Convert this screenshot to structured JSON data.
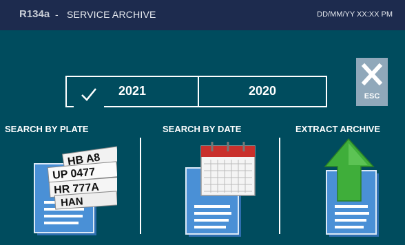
{
  "header": {
    "model": "R134a",
    "separator": "-",
    "title": "SERVICE ARCHIVE",
    "datetime": "DD/MM/YY XX:XX PM"
  },
  "year_selector": {
    "years": [
      {
        "label": "2021",
        "selected": true
      },
      {
        "label": "2020",
        "selected": false
      }
    ]
  },
  "esc_button": {
    "label": "ESC"
  },
  "options": [
    {
      "label": "SEARCH BY PLATE",
      "icon": "license-plates-document-icon"
    },
    {
      "label": "SEARCH BY DATE",
      "icon": "calendar-document-icon"
    },
    {
      "label": "EXTRACT ARCHIVE",
      "icon": "export-arrow-document-icon"
    }
  ],
  "plate_icon_text": [
    "HB A8",
    "UP 0477",
    "HR 777A",
    "HAN"
  ],
  "colors": {
    "background": "#004c5e",
    "header": "#1d2b4e",
    "document": "#3b82c4",
    "arrow": "#3fae3a",
    "esc_button": "#90a8ba"
  }
}
